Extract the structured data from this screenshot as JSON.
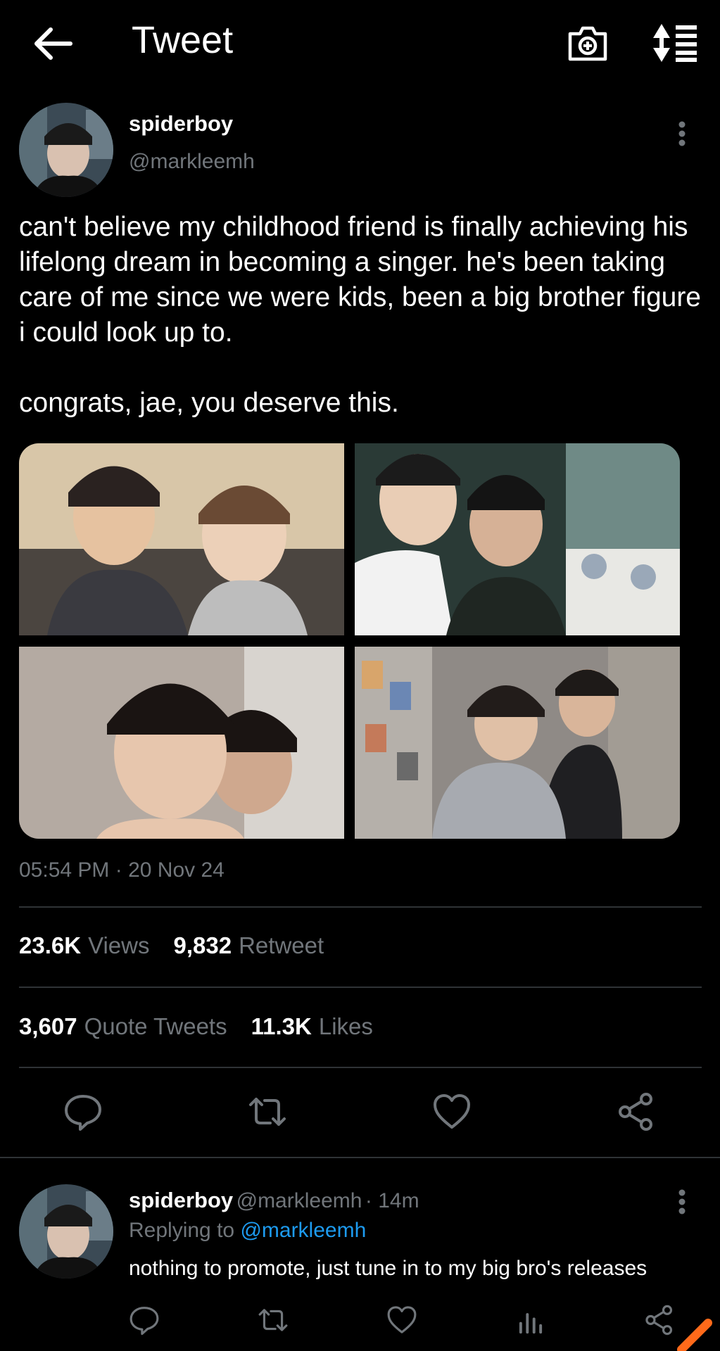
{
  "header": {
    "title": "Tweet"
  },
  "tweet": {
    "display_name": "spiderboy",
    "handle": "@markleemh",
    "text": "can't believe my childhood friend is finally achieving his lifelong dream in becoming a singer. he's been taking care of me since we were kids, been a big brother figure i could look up to.\n\ncongrats, jae, you deserve this.",
    "timestamp": "05:54 PM · 20 Nov 24",
    "stats": {
      "views_count": "23.6K",
      "views_label": "Views",
      "retweets_count": "9,832",
      "retweets_label": "Retweet",
      "quotes_count": "3,607",
      "quotes_label": "Quote Tweets",
      "likes_count": "11.3K",
      "likes_label": "Likes"
    }
  },
  "reply": {
    "display_name": "spiderboy",
    "handle": "@markleemh",
    "time": "· 14m",
    "replying_prefix": "Replying to",
    "replying_handle": "@markleemh",
    "text": "nothing to promote, just tune in to my big bro's releases"
  },
  "icons": {
    "back": "arrow-left-icon",
    "camera": "camera-plus-icon",
    "sort": "sort-icon",
    "more": "more-vertical-icon",
    "reply": "reply-icon",
    "retweet": "retweet-icon",
    "like": "heart-icon",
    "share": "share-icon",
    "analytics": "analytics-icon"
  },
  "colors": {
    "background": "#000000",
    "muted": "#71767b",
    "link": "#1d9bf0",
    "divider": "#2f3336",
    "accent": "#ff6a1a"
  }
}
